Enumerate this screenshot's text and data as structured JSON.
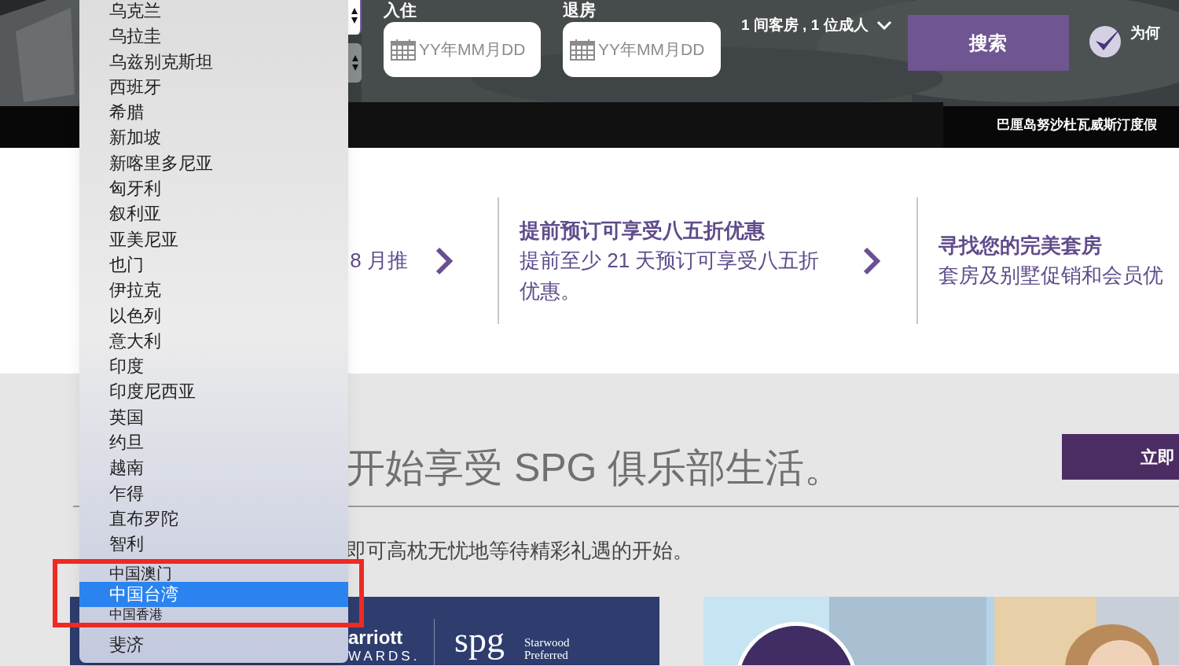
{
  "booking": {
    "check_in": {
      "label": "入住",
      "placeholder": "YY年MM月DD"
    },
    "check_out": {
      "label": "退房",
      "placeholder": "YY年MM月DD"
    },
    "guests": "1 间客房 , 1 位成人",
    "search_button": "搜索",
    "why_text": "为何",
    "caption": "巴厘岛努沙杜瓦威斯汀度假"
  },
  "promos": [
    {
      "text": "8 月推"
    },
    {
      "title": "提前预订可享受八五折优惠",
      "text": "提前至少 21 天预订可享受八五折优惠。"
    },
    {
      "title": "寻找您的完美套房",
      "text": "套房及别墅促销和会员优"
    }
  ],
  "membership": {
    "heading": "开始享受 SPG 俱乐部生活。",
    "join_button": "立即",
    "text": "即可高枕无忧地等待精彩礼遇的开始。",
    "logo_texts": [
      "arriott",
      "WARDS.",
      "spg",
      "Starwood",
      "Preferred"
    ]
  },
  "country_dropdown": {
    "items": [
      {
        "label": "乌克兰",
        "selected": false
      },
      {
        "label": "乌拉圭",
        "selected": false
      },
      {
        "label": "乌兹别克斯坦",
        "selected": false
      },
      {
        "label": "西班牙",
        "selected": false
      },
      {
        "label": "希腊",
        "selected": false
      },
      {
        "label": "新加坡",
        "selected": false
      },
      {
        "label": "新喀里多尼亚",
        "selected": false
      },
      {
        "label": "匈牙利",
        "selected": false
      },
      {
        "label": "叙利亚",
        "selected": false
      },
      {
        "label": "亚美尼亚",
        "selected": false
      },
      {
        "label": "也门",
        "selected": false
      },
      {
        "label": "伊拉克",
        "selected": false
      },
      {
        "label": "以色列",
        "selected": false
      },
      {
        "label": "意大利",
        "selected": false
      },
      {
        "label": "印度",
        "selected": false
      },
      {
        "label": "印度尼西亚",
        "selected": false
      },
      {
        "label": "英国",
        "selected": false
      },
      {
        "label": "约旦",
        "selected": false
      },
      {
        "label": "越南",
        "selected": false
      },
      {
        "label": "乍得",
        "selected": false
      },
      {
        "label": "直布罗陀",
        "selected": false
      },
      {
        "label": "智利",
        "selected": false
      },
      {
        "label": "中国澳门",
        "selected": false
      },
      {
        "label": "中国台湾",
        "selected": true
      },
      {
        "label": "中国香港",
        "selected": false
      },
      {
        "label": "斐济",
        "selected": false
      }
    ]
  }
}
